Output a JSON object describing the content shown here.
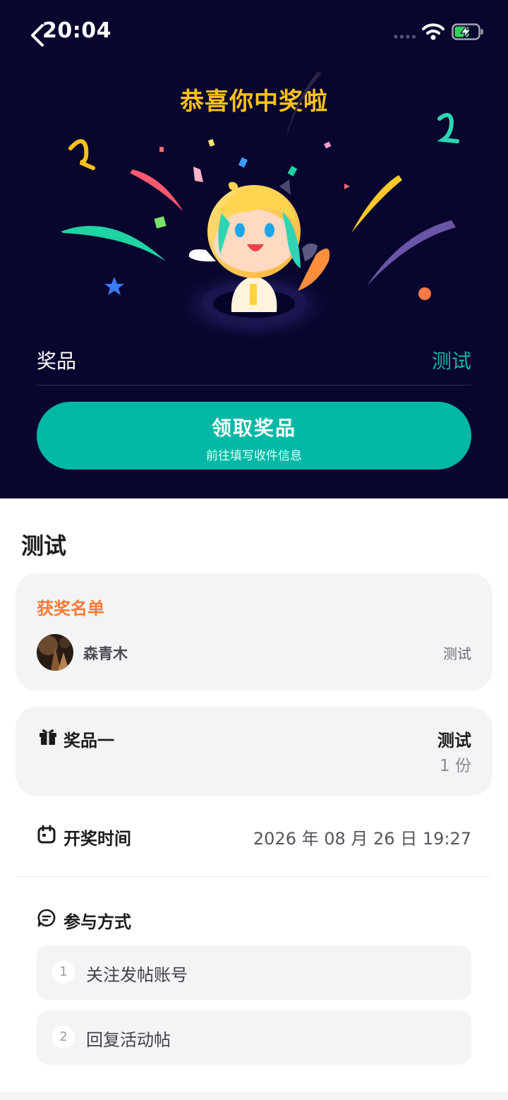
{
  "status_bar": {
    "time": "20:04"
  },
  "hero": {
    "title": "恭喜你中奖啦",
    "prize_label": "奖品",
    "prize_value": "测试",
    "claim_button": {
      "title": "领取奖品",
      "subtitle": "前往填写收件信息"
    }
  },
  "main": {
    "heading": "测试",
    "winners": {
      "title": "获奖名单",
      "items": [
        {
          "name": "森青木",
          "prize": "测试"
        }
      ]
    },
    "prize": {
      "name": "奖品一",
      "value": "测试",
      "count": "1 份"
    },
    "draw_time": {
      "label": "开奖时间",
      "value": "2026 年 08 月 26 日 19:27"
    },
    "participate": {
      "label": "参与方式",
      "steps": [
        {
          "num": "1",
          "text": "关注发帖账号"
        },
        {
          "num": "2",
          "text": "回复活动帖"
        }
      ]
    }
  },
  "colors": {
    "hero_background": "#08052e",
    "title_yellow": "#ffc21a",
    "accent_teal": "#00b8a6",
    "winners_orange": "#ff7a35",
    "card_background": "#f3f4f6"
  },
  "icons": [
    "back-icon",
    "signal-icon",
    "wifi-icon",
    "battery-charging-icon",
    "gift-icon",
    "calendar-icon",
    "chat-icon"
  ]
}
